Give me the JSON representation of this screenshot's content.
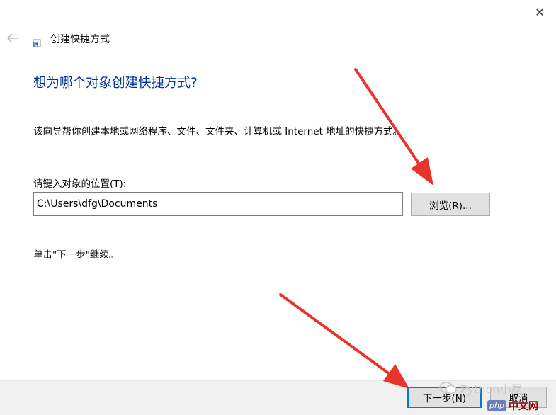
{
  "window": {
    "title": "创建快捷方式",
    "close_glyph": "✕",
    "back_icon": "back-arrow-icon",
    "app_icon": "shortcut-icon"
  },
  "wizard": {
    "heading": "想为哪个对象创建快捷方式?",
    "description": "该向导帮你创建本地或网络程序、文件、文件夹、计算机或 Internet 地址的快捷方式。",
    "location_label": "请键入对象的位置(T):",
    "location_value": "C:\\Users\\dfg\\Documents",
    "browse_label": "浏览(R)...",
    "continue_hint": "单击\"下一步\"继续。"
  },
  "footer": {
    "next_label": "下一步(N)",
    "cancel_label": "取消"
  },
  "watermarks": {
    "wechat_name": "Python小屋",
    "php_badge": "php",
    "php_site": "中文网"
  },
  "colors": {
    "heading": "#003399",
    "arrow": "#e8342a",
    "default_button_border": "#0078d7",
    "footer_bg": "#f0f0f0"
  }
}
